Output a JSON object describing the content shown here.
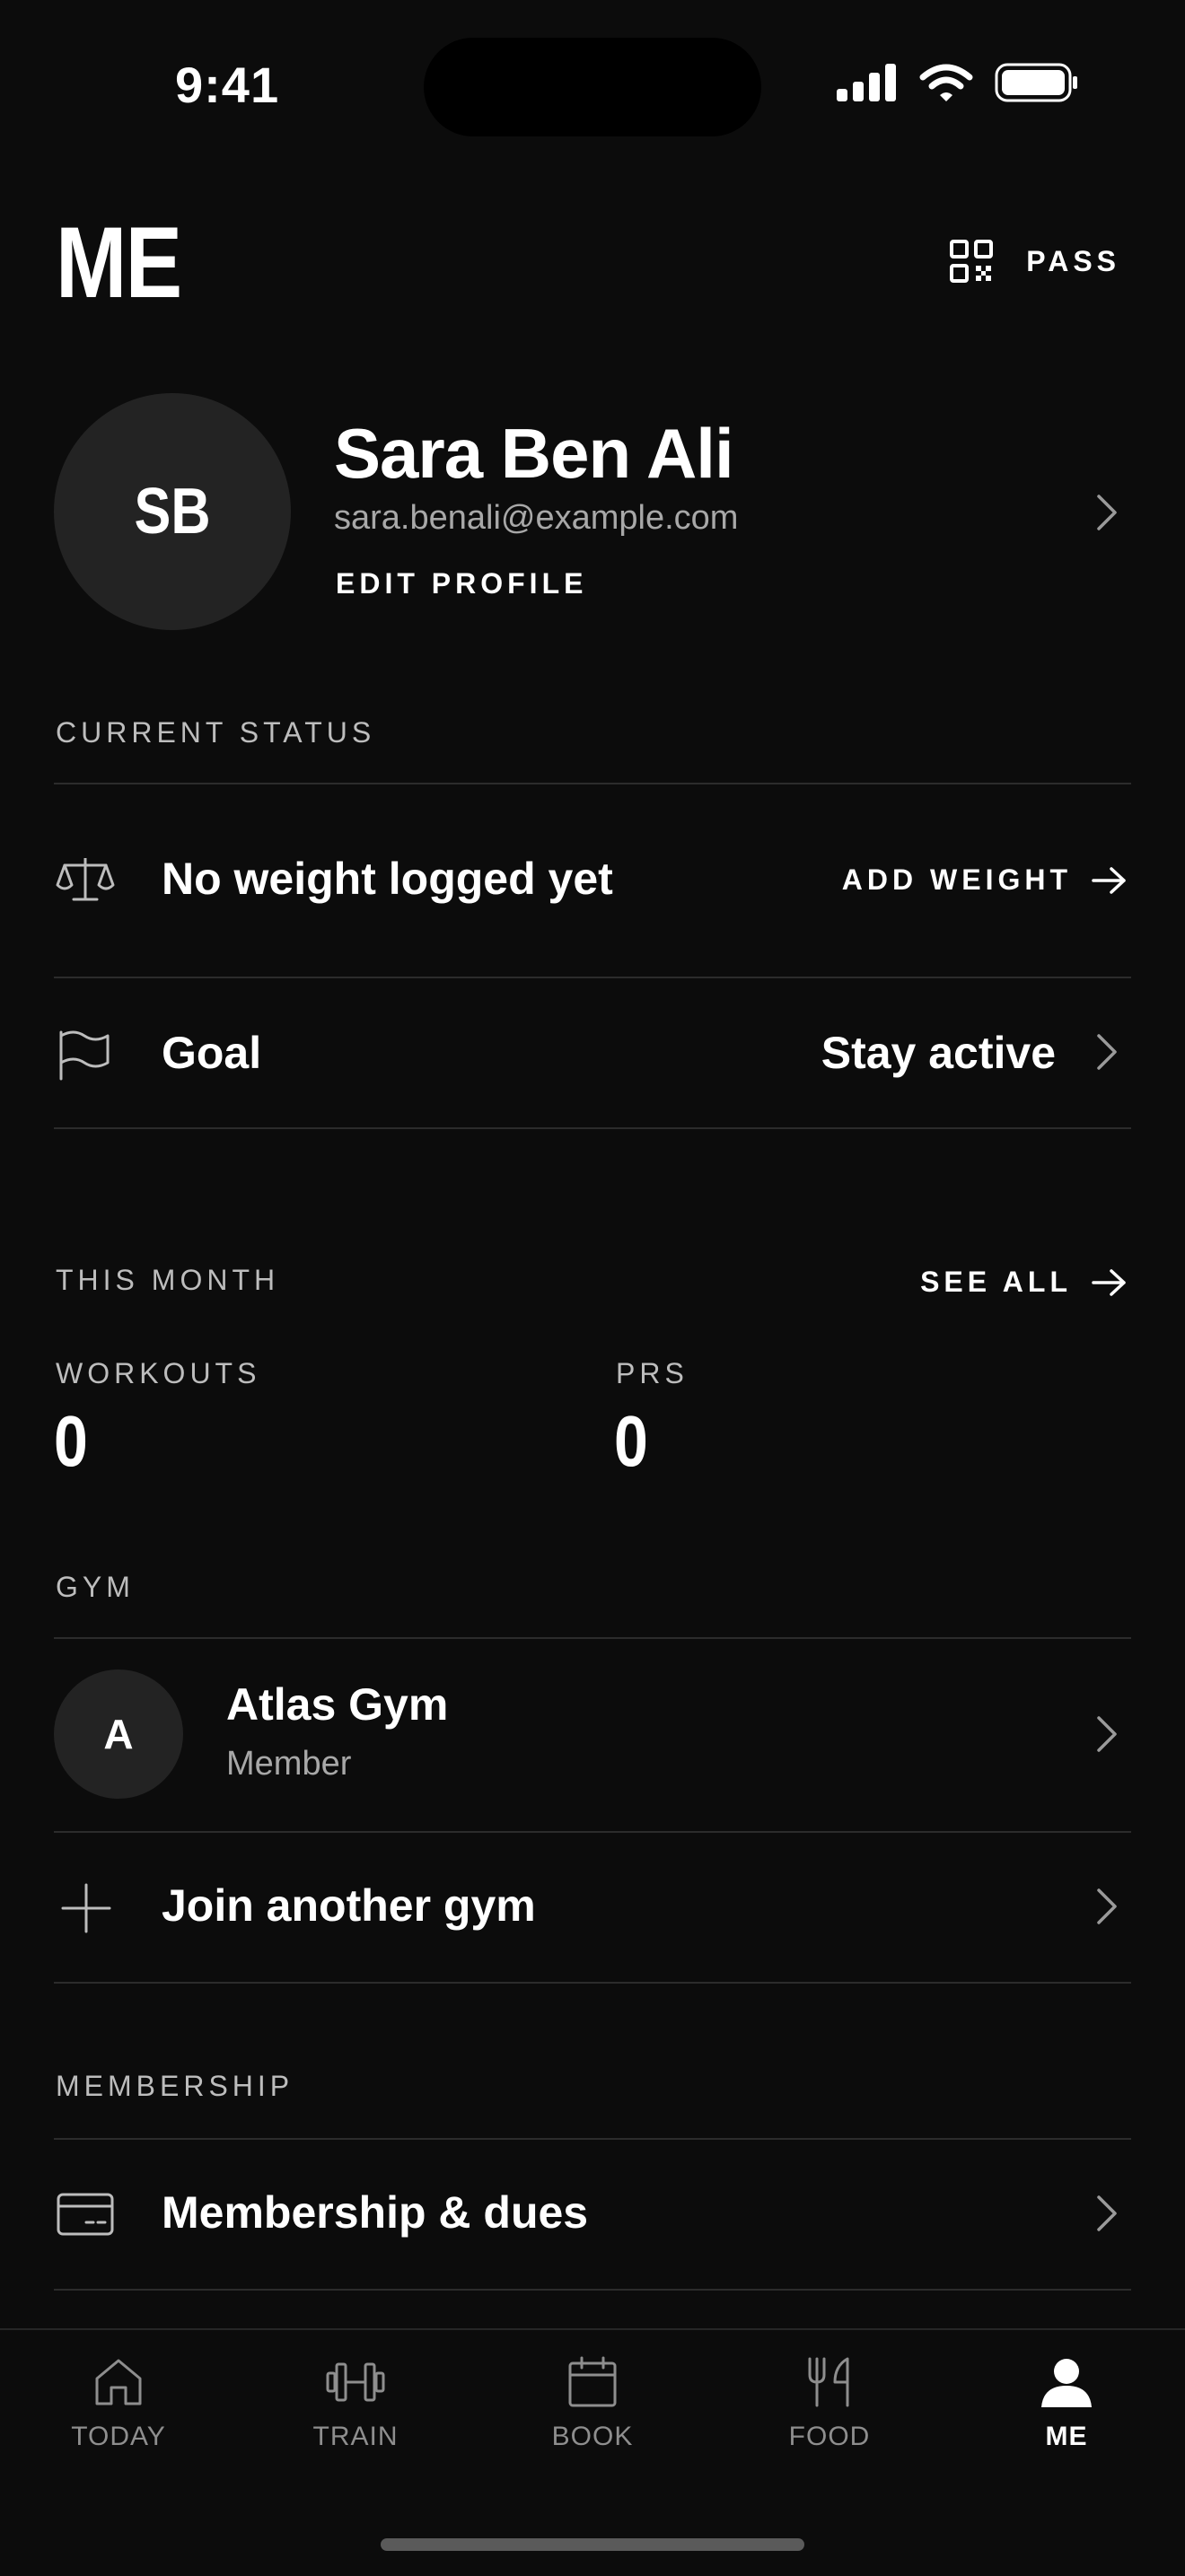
{
  "status_bar": {
    "time": "9:41"
  },
  "header": {
    "title": "ME",
    "pass_label": "PASS",
    "pass_icon": "qr-code-icon"
  },
  "profile": {
    "initials": "SB",
    "name": "Sara Ben Ali",
    "email": "sara.benali@example.com",
    "edit_label": "EDIT PROFILE"
  },
  "current_status": {
    "label": "CURRENT STATUS",
    "weight": {
      "icon": "scale-icon",
      "text": "No weight logged yet",
      "action": "ADD WEIGHT"
    },
    "goal": {
      "icon": "flag-icon",
      "label": "Goal",
      "value": "Stay active"
    }
  },
  "this_month": {
    "label": "THIS MONTH",
    "see_all": "SEE ALL",
    "workouts_label": "WORKOUTS",
    "workouts_value": "0",
    "prs_label": "PRS",
    "prs_value": "0"
  },
  "gym": {
    "label": "GYM",
    "initial": "A",
    "name": "Atlas Gym",
    "role": "Member",
    "join_label": "Join another gym"
  },
  "membership": {
    "label": "MEMBERSHIP",
    "item_label": "Membership & dues",
    "icon": "card-icon"
  },
  "tabs": [
    {
      "label": "TODAY",
      "icon": "home-icon",
      "active": false
    },
    {
      "label": "TRAIN",
      "icon": "dumbbell-icon",
      "active": false
    },
    {
      "label": "BOOK",
      "icon": "calendar-icon",
      "active": false
    },
    {
      "label": "FOOD",
      "icon": "fork-knife-icon",
      "active": false
    },
    {
      "label": "ME",
      "icon": "person-icon",
      "active": true
    }
  ],
  "colors": {
    "background": "#0c0c0c",
    "text": "#ffffff",
    "muted": "#a8a8a8",
    "divider": "#2c2c2c",
    "avatar_bg": "#232323"
  }
}
